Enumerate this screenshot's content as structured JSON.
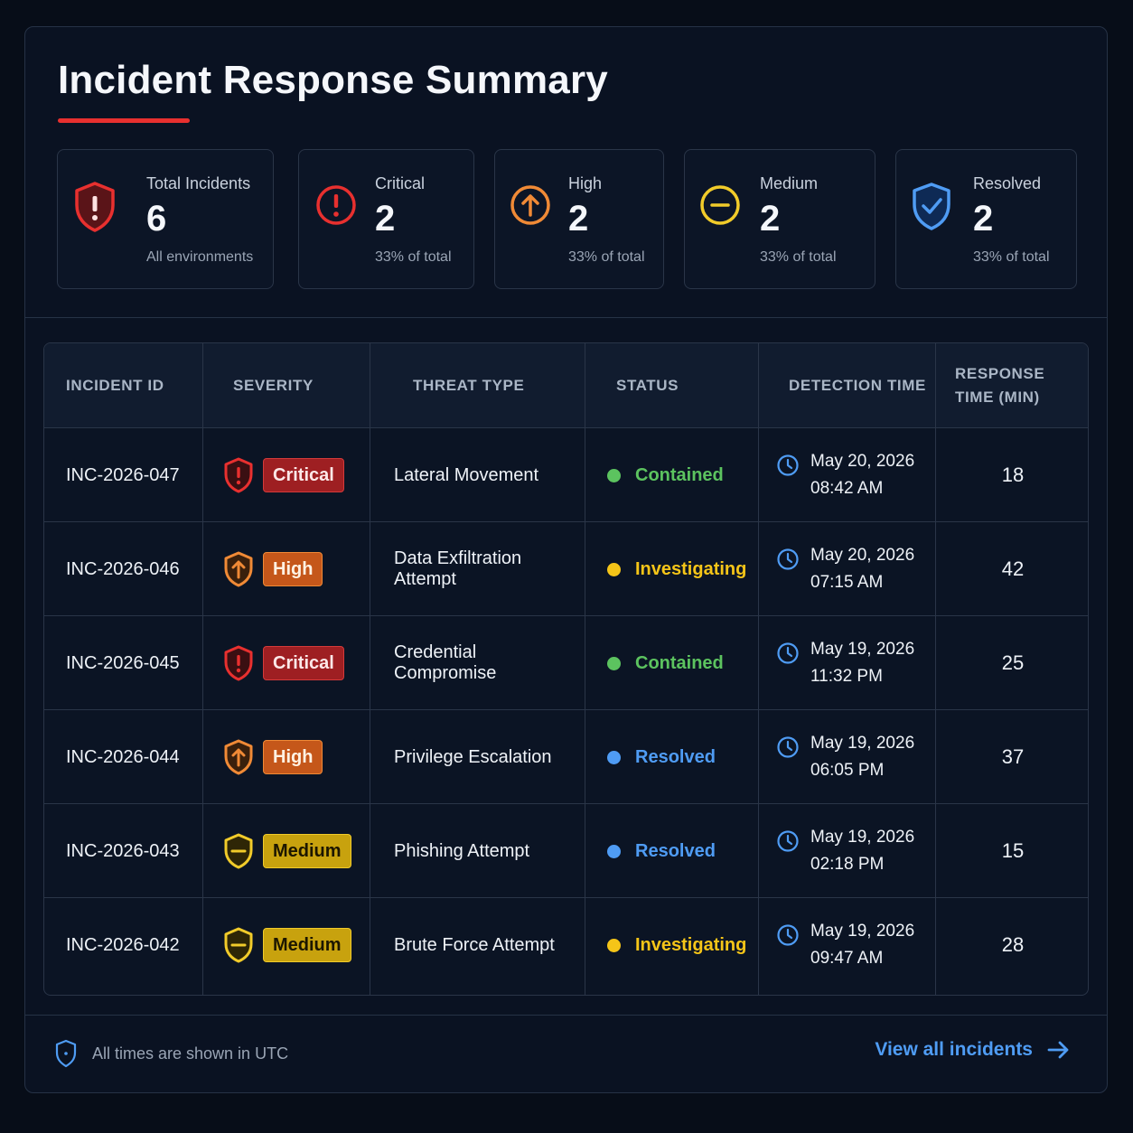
{
  "header": {
    "title": "Incident Response Summary"
  },
  "cards": [
    {
      "label": "Total Incidents",
      "value": "6",
      "sub": "All environments",
      "icon": "shield-alert-icon",
      "color": "#e8302f"
    },
    {
      "label": "Critical",
      "value": "2",
      "sub": "33% of total",
      "icon": "alert-circle-icon",
      "color": "#e8302f"
    },
    {
      "label": "High",
      "value": "2",
      "sub": "33% of total",
      "icon": "arrow-up-circle-icon",
      "color": "#f08a36"
    },
    {
      "label": "Medium",
      "value": "2",
      "sub": "33% of total",
      "icon": "minus-circle-icon",
      "color": "#f1cb2a"
    },
    {
      "label": "Resolved",
      "value": "2",
      "sub": "33% of total",
      "icon": "shield-check-icon",
      "color": "#4f9cf4"
    }
  ],
  "table": {
    "headers": [
      "INCIDENT ID",
      "SEVERITY",
      "THREAT TYPE",
      "STATUS",
      "DETECTION TIME",
      "RESPONSE TIME (MIN)"
    ],
    "rows": [
      {
        "id": "INC-2026-047",
        "severity": "Critical",
        "threat": "Lateral Movement",
        "status": "Contained",
        "date": "May 20, 2026",
        "time": "08:42 AM",
        "response": "18"
      },
      {
        "id": "INC-2026-046",
        "severity": "High",
        "threat": "Data Exfiltration Attempt",
        "status": "Investigating",
        "date": "May 20, 2026",
        "time": "07:15 AM",
        "response": "42"
      },
      {
        "id": "INC-2026-045",
        "severity": "Critical",
        "threat": "Credential Compromise",
        "status": "Contained",
        "date": "May 19, 2026",
        "time": "11:32 PM",
        "response": "25"
      },
      {
        "id": "INC-2026-044",
        "severity": "High",
        "threat": "Privilege Escalation",
        "status": "Resolved",
        "date": "May 19, 2026",
        "time": "06:05 PM",
        "response": "37"
      },
      {
        "id": "INC-2026-043",
        "severity": "Medium",
        "threat": "Phishing Attempt",
        "status": "Resolved",
        "date": "May 19, 2026",
        "time": "02:18 PM",
        "response": "15"
      },
      {
        "id": "INC-2026-042",
        "severity": "Medium",
        "threat": "Brute Force Attempt",
        "status": "Investigating",
        "date": "May 19, 2026",
        "time": "09:47 AM",
        "response": "28"
      }
    ]
  },
  "status_colors": {
    "Contained": "#5cc35f",
    "Investigating": "#f5c518",
    "Resolved": "#4f9cf4"
  },
  "severity_colors": {
    "Critical": "#e8302f",
    "High": "#f08a36",
    "Medium": "#f1cb2a"
  },
  "footer": {
    "note": "All times are shown in UTC",
    "link": "View all incidents"
  }
}
